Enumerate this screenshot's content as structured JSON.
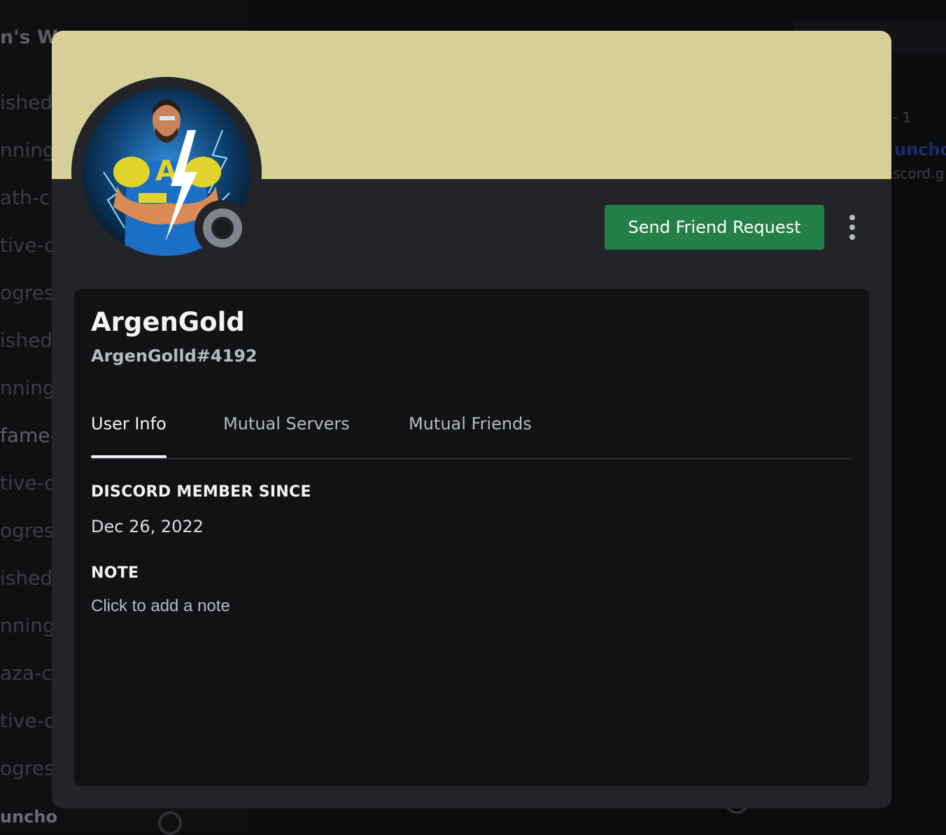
{
  "background": {
    "server_name": "n's Wo",
    "channels": [
      "ished-",
      "nning-",
      "ath-cl",
      "tive-o",
      "ogress",
      "ished-",
      "nning-",
      "fame-",
      "tive-o",
      "ogress",
      "ished-",
      "nning-",
      "aza-cl",
      "tive-o",
      "ogress"
    ],
    "user": "uncho",
    "right_count": "- 1",
    "right_link": "uncho",
    "right_sub": "scord.g"
  },
  "profile": {
    "banner_color": "#d6d098",
    "avatar_icon": "superhero-avatar",
    "status": "offline",
    "display_name": "ArgenGold",
    "username": "ArgenGolld#4192",
    "friend_button": "Send Friend Request",
    "more_icon": "more-vertical-icon",
    "tabs": [
      {
        "label": "User Info",
        "active": true
      },
      {
        "label": "Mutual Servers",
        "active": false
      },
      {
        "label": "Mutual Friends",
        "active": false
      }
    ],
    "member_since_label": "DISCORD MEMBER SINCE",
    "member_since_value": "Dec 26, 2022",
    "note_label": "NOTE",
    "note_placeholder": "Click to add a note"
  }
}
